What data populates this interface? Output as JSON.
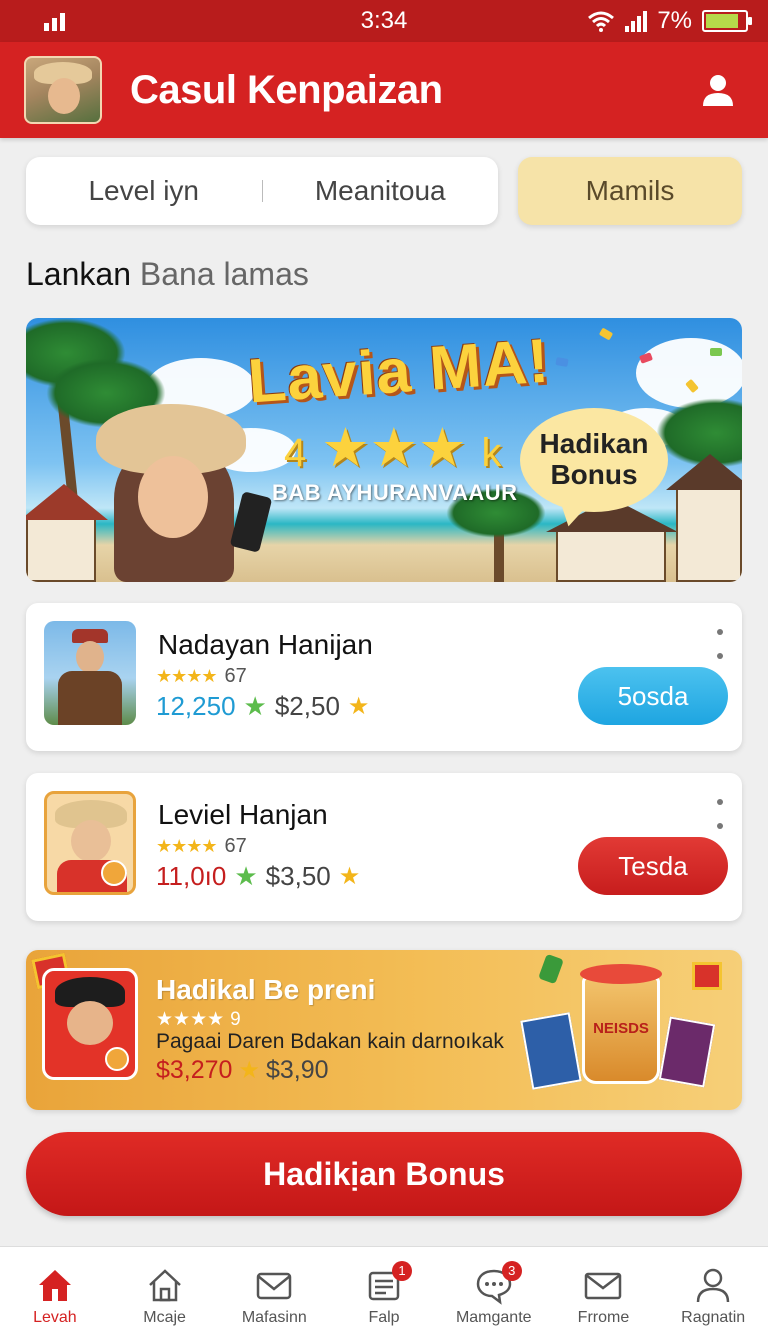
{
  "status_bar": {
    "time": "3:34",
    "battery": "7%",
    "battery_level": 0.85
  },
  "header": {
    "title": "Casul Kenpaizan"
  },
  "tabs": {
    "items": [
      "Level iyn",
      "Meanitoua"
    ],
    "chip": "Mamils"
  },
  "section": {
    "title_part1": "Lankan",
    "title_part2": "Bana lamas"
  },
  "banner": {
    "headline": "Lavia MA!",
    "side_left": "4",
    "side_right": "k",
    "subtitle": "BAB AYHURANVAAUR",
    "bubble_line1": "Hadikan",
    "bubble_line2": "Bonus"
  },
  "cards": [
    {
      "name": "Nadayan Hanijan",
      "stars": "★★★★",
      "rating": "67",
      "amount": "12,250",
      "price": "$2,50",
      "button": "5osda",
      "button_style": "blue"
    },
    {
      "name": "Leviel Hanjan",
      "stars": "★★★★",
      "rating": "67",
      "amount": "11,0ı0",
      "price": "$3,50",
      "button": "Tesda",
      "button_style": "red"
    }
  ],
  "promo": {
    "title": "Hadikal Be preni",
    "stars": "★★★★",
    "rating": "9",
    "description": "Pagaai Daren Bdakan kain darnoıkak",
    "amount": "$3,270",
    "price": "$3,90",
    "cup_label": "NEISDS"
  },
  "cta": {
    "label": "Hadikịan Bonus"
  },
  "nav": [
    {
      "label": "Levah",
      "icon": "home-icon",
      "active": true,
      "badge": ""
    },
    {
      "label": "Mcaje",
      "icon": "house-outline-icon",
      "active": false,
      "badge": ""
    },
    {
      "label": "Mafasinn",
      "icon": "mail-heart-icon",
      "active": false,
      "badge": ""
    },
    {
      "label": "Falp",
      "icon": "document-icon",
      "active": false,
      "badge": "1"
    },
    {
      "label": "Mamgante",
      "icon": "chat-icon",
      "active": false,
      "badge": "3"
    },
    {
      "label": "Frrome",
      "icon": "envelope-icon",
      "active": false,
      "badge": ""
    },
    {
      "label": "Ragnatin",
      "icon": "profile-icon",
      "active": false,
      "badge": ""
    }
  ],
  "colors": {
    "brand_red": "#d52222",
    "accent_yellow": "#f6e3a8",
    "blue_button": "#1ea5e1"
  }
}
